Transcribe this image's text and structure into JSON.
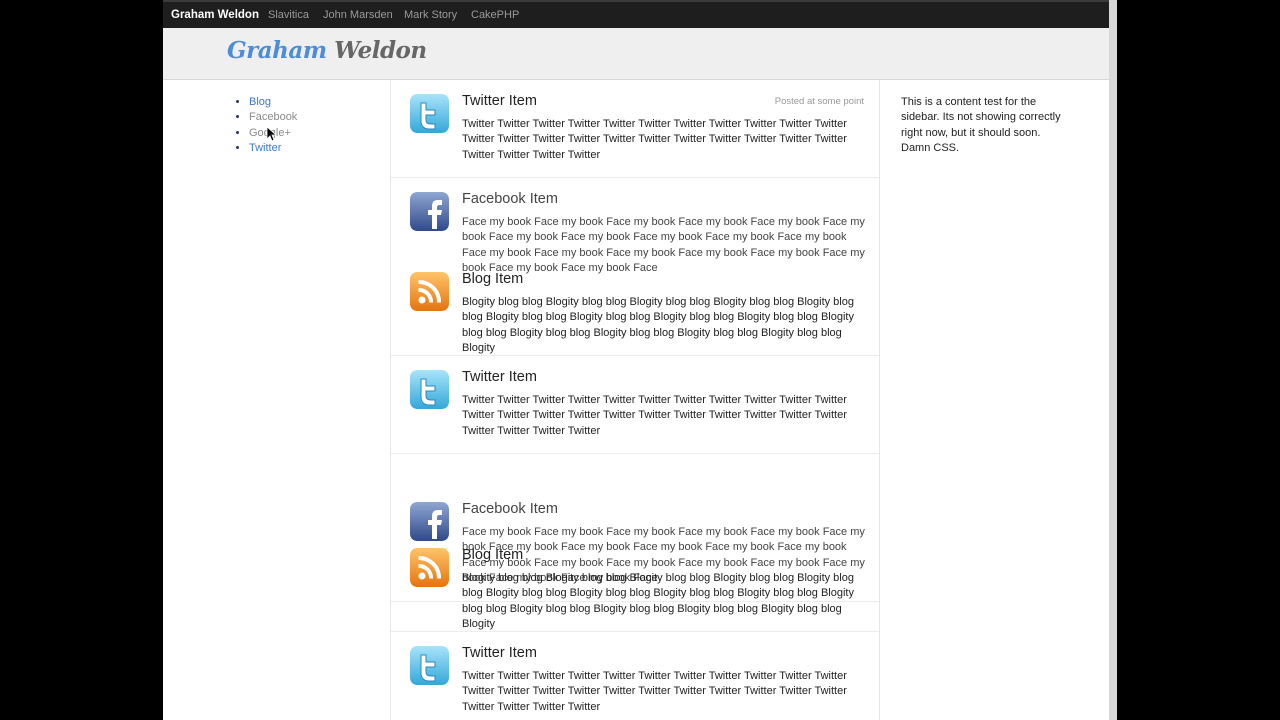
{
  "topnav": {
    "brand": "Graham Weldon",
    "links": [
      "Slavitica",
      "John Marsden",
      "Mark Story",
      "CakePHP"
    ]
  },
  "logo": {
    "first": "Graham",
    "last": "Weldon"
  },
  "leftnav": {
    "items": [
      "Blog",
      "Facebook",
      "Google+",
      "Twitter"
    ]
  },
  "sidebar": {
    "text": "This is a content test for the sidebar. Its not showing correctly right now, but it should soon. Damn CSS."
  },
  "items": [
    {
      "type": "twitter",
      "title": "Twitter Item",
      "meta": "Posted at some point",
      "body": "Twitter Twitter Twitter Twitter Twitter Twitter Twitter Twitter Twitter Twitter Twitter Twitter Twitter Twitter Twitter Twitter Twitter Twitter Twitter Twitter Twitter Twitter Twitter Twitter Twitter Twitter"
    },
    {
      "type": "facebook",
      "title": "Facebook Item",
      "body": "Face my book Face my book Face my book Face my book Face my book Face my book Face my book Face my book Face my book Face my book Face my book Face my book Face my book Face my book Face my book Face my book Face my book Face my book Face my book Face"
    },
    {
      "type": "blog",
      "title": "Blog Item",
      "body": "Blogity blog blog Blogity blog blog Blogity blog blog Blogity blog blog Blogity blog blog Blogity blog blog Blogity blog blog Blogity blog blog Blogity blog blog Blogity blog blog Blogity blog blog Blogity blog blog Blogity blog blog Blogity blog blog Blogity"
    },
    {
      "type": "twitter",
      "title": "Twitter Item",
      "body": "Twitter Twitter Twitter Twitter Twitter Twitter Twitter Twitter Twitter Twitter Twitter Twitter Twitter Twitter Twitter Twitter Twitter Twitter Twitter Twitter Twitter Twitter Twitter Twitter Twitter Twitter"
    },
    {
      "type": "facebook",
      "title": "Facebook Item",
      "body": "Face my book Face my book Face my book Face my book Face my book Face my book Face my book Face my book Face my book Face my book Face my book Face my book Face my book Face my book Face my book Face my book Face my book Face my book Face my book Face"
    },
    {
      "type": "blog",
      "title": "Blog Item",
      "body": "Blogity blog blog Blogity blog blog Blogity blog blog Blogity blog blog Blogity blog blog Blogity blog blog Blogity blog blog Blogity blog blog Blogity blog blog Blogity blog blog Blogity blog blog Blogity blog blog Blogity blog blog Blogity blog blog Blogity"
    },
    {
      "type": "twitter",
      "title": "Twitter Item",
      "body": "Twitter Twitter Twitter Twitter Twitter Twitter Twitter Twitter Twitter Twitter Twitter Twitter Twitter Twitter Twitter Twitter Twitter Twitter Twitter Twitter Twitter Twitter Twitter Twitter Twitter Twitter"
    }
  ]
}
